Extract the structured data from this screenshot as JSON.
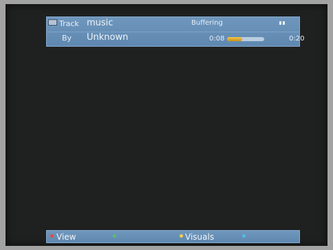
{
  "info_panel": {
    "track_label": "Track",
    "track_value": "music",
    "status": "Buffering",
    "by_label": "By",
    "by_value": "Unknown",
    "time_elapsed": "0:08",
    "time_total": "0:20",
    "progress_fraction": 0.4,
    "icons": {
      "media": "film-icon",
      "state": "pause-icon"
    }
  },
  "bottom_bar": {
    "buttons": [
      {
        "color": "#e04a4a",
        "label": "View"
      },
      {
        "color": "#55c06a",
        "label": ""
      },
      {
        "color": "#f1d24b",
        "label": "Visuals"
      },
      {
        "color": "#57b9e6",
        "label": ""
      }
    ]
  }
}
